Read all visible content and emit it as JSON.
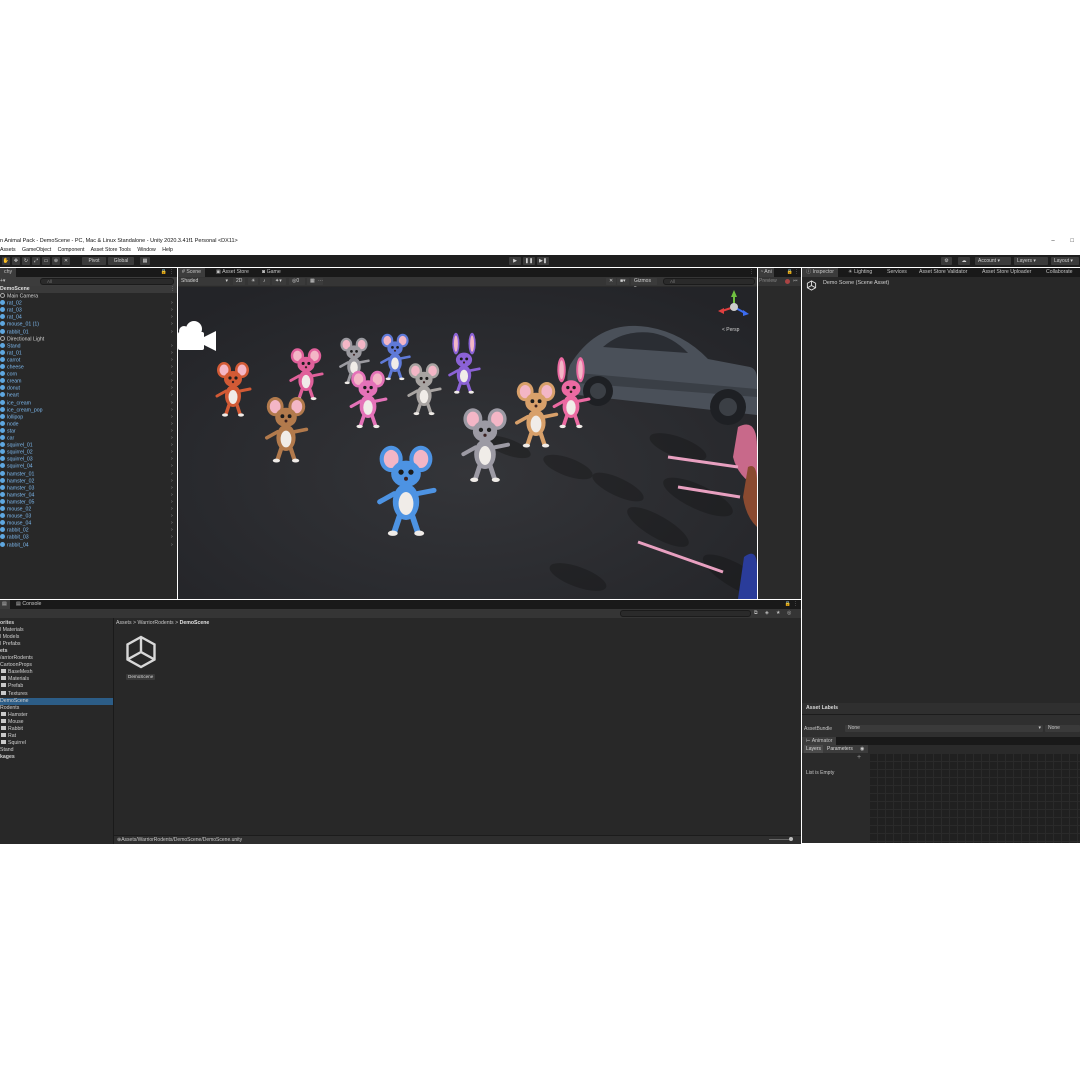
{
  "window": {
    "title": "n Animal Pack - DemoScene - PC, Mac & Linux Standalone - Unity 2020.3.41f1 Personal <DX11>",
    "minimize": "–",
    "maximize": "□"
  },
  "menu": [
    "Assets",
    "GameObject",
    "Component",
    "Asset Store Tools",
    "Window",
    "Help"
  ],
  "toolbar": {
    "pivot": "Pivot",
    "global": "Global",
    "account": "Account",
    "layers": "Layers",
    "layout": "Layout"
  },
  "hierarchy": {
    "tab": "chy",
    "search_placeholder": "All",
    "scene": "DemoScene",
    "items": [
      {
        "name": "Main Camera",
        "kind": "plain"
      },
      {
        "name": "rat_02",
        "kind": "prefab"
      },
      {
        "name": "rat_03",
        "kind": "prefab"
      },
      {
        "name": "rat_04",
        "kind": "prefab"
      },
      {
        "name": "mouse_01 (1)",
        "kind": "prefab"
      },
      {
        "name": "rabbit_01",
        "kind": "prefab"
      },
      {
        "name": "Directional Light",
        "kind": "plain"
      },
      {
        "name": "Stand",
        "kind": "prefab"
      },
      {
        "name": "rat_01",
        "kind": "prefab"
      },
      {
        "name": "carrot",
        "kind": "prefab"
      },
      {
        "name": "cheese",
        "kind": "prefab"
      },
      {
        "name": "corn",
        "kind": "prefab"
      },
      {
        "name": "cream",
        "kind": "prefab"
      },
      {
        "name": "donut",
        "kind": "prefab"
      },
      {
        "name": "heart",
        "kind": "prefab"
      },
      {
        "name": "ice_cream",
        "kind": "prefab"
      },
      {
        "name": "ice_cream_pop",
        "kind": "prefab"
      },
      {
        "name": "lollipop",
        "kind": "prefab"
      },
      {
        "name": "node",
        "kind": "prefab"
      },
      {
        "name": "star",
        "kind": "prefab"
      },
      {
        "name": "car",
        "kind": "prefab"
      },
      {
        "name": "squirrel_01",
        "kind": "prefab"
      },
      {
        "name": "squirrel_02",
        "kind": "prefab"
      },
      {
        "name": "squirrel_03",
        "kind": "prefab"
      },
      {
        "name": "squirrel_04",
        "kind": "prefab"
      },
      {
        "name": "hamster_01",
        "kind": "prefab"
      },
      {
        "name": "hamster_02",
        "kind": "prefab"
      },
      {
        "name": "hamster_03",
        "kind": "prefab"
      },
      {
        "name": "hamster_04",
        "kind": "prefab"
      },
      {
        "name": "hamster_05",
        "kind": "prefab"
      },
      {
        "name": "mouse_02",
        "kind": "prefab"
      },
      {
        "name": "mouse_03",
        "kind": "prefab"
      },
      {
        "name": "mouse_04",
        "kind": "prefab"
      },
      {
        "name": "rabbit_02",
        "kind": "prefab"
      },
      {
        "name": "rabbit_03",
        "kind": "prefab"
      },
      {
        "name": "rabbit_04",
        "kind": "prefab"
      }
    ]
  },
  "scene_tabs": [
    "Scene",
    "Asset Store",
    "Game"
  ],
  "scene_bar": {
    "shading": "Shaded",
    "mode2d": "2D",
    "gizmos": "Gizmos",
    "search_placeholder": "All",
    "persp": "< Persp",
    "hidden_count": "0"
  },
  "animation_tab": {
    "label": "Ani",
    "preview": "Preview"
  },
  "inspector": {
    "tabs": [
      "Inspector",
      "Lighting",
      "Services",
      "Asset Store Validator",
      "Asset Store Uploader",
      "Collaborate"
    ],
    "asset_name": "Demo Scene (Scene Asset)",
    "asset_labels": "Asset Labels",
    "assetbundle_label": "AssetBundle",
    "assetbundle_value": "None",
    "variant_value": "None"
  },
  "animator": {
    "tab": "Animator",
    "subtabs": [
      "Layers",
      "Parameters"
    ],
    "empty": "List is Empty",
    "add": "+"
  },
  "console": {
    "tab": "Console"
  },
  "project": {
    "breadcrumb": [
      "Assets",
      "WarriorRodents",
      "DemoScene"
    ],
    "asset": "DemoScene",
    "path": "Assets/WarriorRodents/DemoScene/DemoScene.unity",
    "tree": [
      {
        "label": "orites",
        "indent": 0,
        "folder": false,
        "bold": true
      },
      {
        "label": "l Materials",
        "indent": 0,
        "folder": false,
        "bold": false
      },
      {
        "label": "l Models",
        "indent": 0,
        "folder": false,
        "bold": false
      },
      {
        "label": "l Prefabs",
        "indent": 0,
        "folder": false,
        "bold": false
      },
      {
        "label": "ets",
        "indent": 0,
        "folder": false,
        "bold": true
      },
      {
        "label": "/arriorRodents",
        "indent": 0,
        "folder": false,
        "bold": false
      },
      {
        "label": "CartoonProps",
        "indent": 0,
        "folder": false,
        "bold": false
      },
      {
        "label": "BaseMesh",
        "indent": 1,
        "folder": true,
        "bold": false
      },
      {
        "label": "Materials",
        "indent": 1,
        "folder": true,
        "bold": false
      },
      {
        "label": "Prefab",
        "indent": 1,
        "folder": true,
        "bold": false
      },
      {
        "label": "Textures",
        "indent": 1,
        "folder": true,
        "bold": false
      },
      {
        "label": "DemoScene",
        "indent": 0,
        "folder": false,
        "bold": false,
        "selected": true
      },
      {
        "label": "Rodents",
        "indent": 0,
        "folder": false,
        "bold": false
      },
      {
        "label": "Hamster",
        "indent": 1,
        "folder": true,
        "bold": false
      },
      {
        "label": "Mouse",
        "indent": 1,
        "folder": true,
        "bold": false
      },
      {
        "label": "Rabbit",
        "indent": 1,
        "folder": true,
        "bold": false
      },
      {
        "label": "Rat",
        "indent": 1,
        "folder": true,
        "bold": false
      },
      {
        "label": "Squirrel",
        "indent": 1,
        "folder": true,
        "bold": false
      },
      {
        "label": "Stand",
        "indent": 0,
        "folder": false,
        "bold": false
      },
      {
        "label": "kages",
        "indent": 0,
        "folder": false,
        "bold": true
      }
    ]
  },
  "colors": {
    "editor_bg": "#282828",
    "toolbar_bg": "#1e1e1e",
    "prefab_text": "#7db9ef",
    "selection": "#2c5d87",
    "axis_x": "#e04040",
    "axis_y": "#70c040",
    "axis_z": "#3c6cf0"
  },
  "characters": [
    {
      "kind": "squirrel",
      "color": "#d25a35"
    },
    {
      "kind": "mouse",
      "color": "#e0609a"
    },
    {
      "kind": "rat",
      "color": "#9b9aa0"
    },
    {
      "kind": "mouse",
      "color": "#5f7ad8"
    },
    {
      "kind": "rabbit",
      "color": "#8b62d6"
    },
    {
      "kind": "hamster",
      "color": "#b27a4c"
    },
    {
      "kind": "mouse",
      "color": "#e472b8"
    },
    {
      "kind": "rat",
      "color": "#a8a4a2"
    },
    {
      "kind": "mouse",
      "color": "#4d93e3"
    },
    {
      "kind": "rat",
      "color": "#9c9aa4"
    },
    {
      "kind": "hamster",
      "color": "#d8a06a"
    },
    {
      "kind": "rabbit",
      "color": "#ec6aa2"
    }
  ]
}
